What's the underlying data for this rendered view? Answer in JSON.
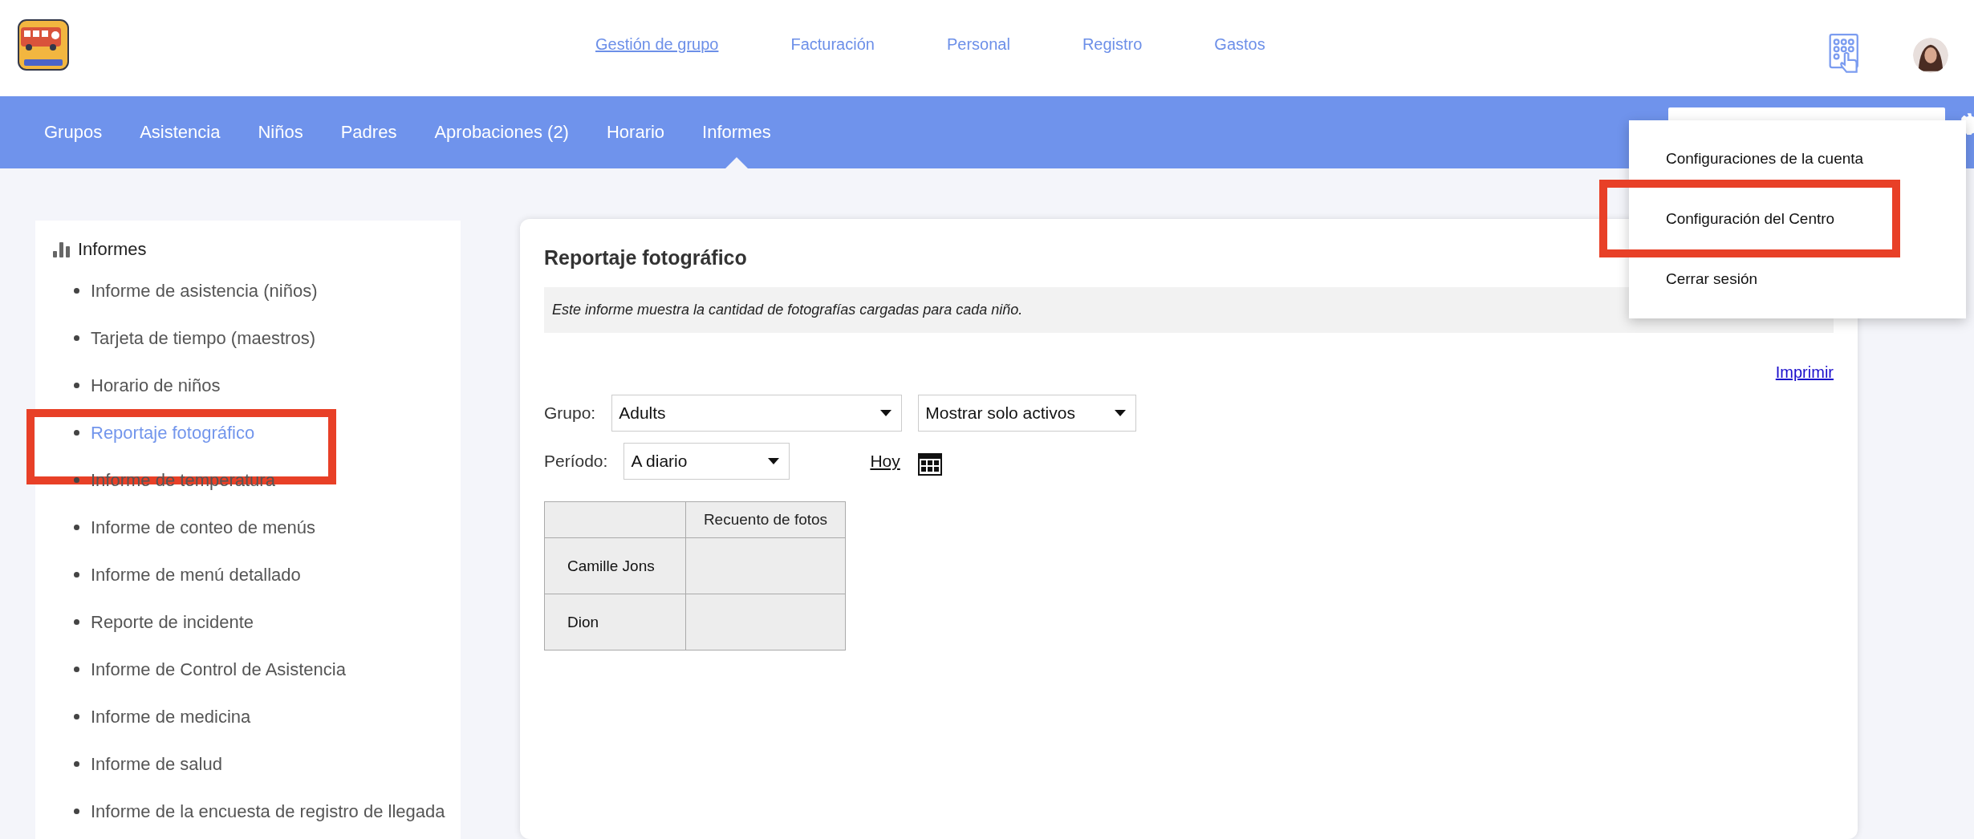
{
  "top_links": [
    {
      "label": "Gestión de grupo",
      "selected": true
    },
    {
      "label": "Facturación",
      "selected": false
    },
    {
      "label": "Personal",
      "selected": false
    },
    {
      "label": "Registro",
      "selected": false
    },
    {
      "label": "Gastos",
      "selected": false
    }
  ],
  "nav_tabs": [
    {
      "label": "Grupos",
      "selected": false
    },
    {
      "label": "Asistencia",
      "selected": false
    },
    {
      "label": "Niños",
      "selected": false
    },
    {
      "label": "Padres",
      "selected": false
    },
    {
      "label": "Aprobaciones (2)",
      "selected": false
    },
    {
      "label": "Horario",
      "selected": false
    },
    {
      "label": "Informes",
      "selected": true
    }
  ],
  "account_menu": {
    "items": [
      {
        "label": "Configuraciones de la cuenta",
        "highlighted": false
      },
      {
        "label": "Configuración del Centro",
        "highlighted": true
      },
      {
        "label": "Cerrar sesión",
        "highlighted": false
      }
    ]
  },
  "sidebar": {
    "title": "Informes",
    "items": [
      {
        "label": "Informe de asistencia (niños)",
        "selected": false,
        "highlighted": false
      },
      {
        "label": "Tarjeta de tiempo (maestros)",
        "selected": false,
        "highlighted": false
      },
      {
        "label": "Horario de niños",
        "selected": false,
        "highlighted": false
      },
      {
        "label": "Reportaje fotográfico",
        "selected": true,
        "highlighted": true
      },
      {
        "label": "Informe de temperatura",
        "selected": false,
        "highlighted": false
      },
      {
        "label": "Informe de conteo de menús",
        "selected": false,
        "highlighted": false
      },
      {
        "label": "Informe de menú detallado",
        "selected": false,
        "highlighted": false
      },
      {
        "label": "Reporte de incidente",
        "selected": false,
        "highlighted": false
      },
      {
        "label": "Informe de Control de Asistencia",
        "selected": false,
        "highlighted": false
      },
      {
        "label": "Informe de medicina",
        "selected": false,
        "highlighted": false
      },
      {
        "label": "Informe de salud",
        "selected": false,
        "highlighted": false
      },
      {
        "label": "Informe de la encuesta de registro de llegada",
        "selected": false,
        "highlighted": false
      }
    ]
  },
  "report": {
    "title": "Reportaje fotográfico",
    "description": "Este informe muestra la cantidad de fotografías cargadas para cada niño.",
    "print_link": "Imprimir",
    "group_label": "Grupo:",
    "group_value": "Adults",
    "filter_value": "Mostrar solo activos",
    "period_label": "Período:",
    "period_value": "A diario",
    "today_link": "Hoy",
    "table": {
      "columns": [
        "Recuento de fotos"
      ],
      "rows": [
        {
          "name": "Camille Jons",
          "count": ""
        },
        {
          "name": "Dion",
          "count": ""
        }
      ]
    }
  }
}
